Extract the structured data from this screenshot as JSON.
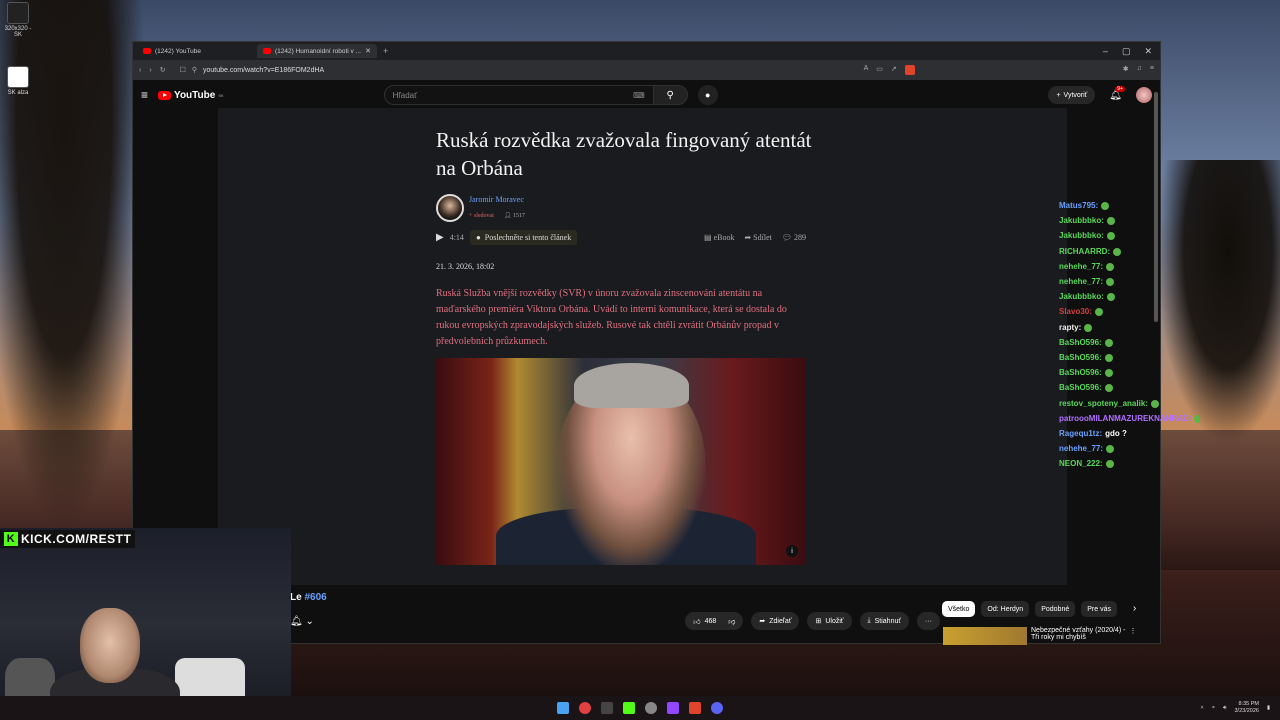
{
  "desktop": {
    "icon1_label": "320x320 - SK",
    "icon2_label": "SK alza"
  },
  "browser": {
    "tabs": [
      {
        "label": "(1242) YouTube"
      },
      {
        "label": "(1242) Humanoidní roboti v ..."
      }
    ],
    "url": "youtube.com/watch?v=E186FOM2dHA"
  },
  "youtube": {
    "logo_text": "YouTube",
    "logo_region": "SK",
    "search_placeholder": "Hľadať",
    "create_label": "Vytvoriť",
    "notif_count": "9+"
  },
  "article": {
    "title": "Ruská rozvědka zvažovala fingovaný atentát na Orbána",
    "author": "Jaromír Moravec",
    "follow": "+ sledovat",
    "readers": "1517",
    "audio_time": "4:14",
    "listen_label": "Poslechněte si tento článek",
    "ebook": "eBook",
    "share": "Sdílet",
    "comments": "289",
    "date": "21. 3. 2026, 18:02",
    "perex": "Ruská Služba vnější rozvědky (SVR) v únoru zvažovala zinscenování atentátu na maďarského premiéra Viktora Orbána. Uvádí to interní komunikace, která se dostala do rukou evropských zpravodajských služeb. Rusové tak chtěli zvrátit Orbánův propad v předvolebních průzkumech."
  },
  "chat": [
    {
      "user": "Matus795:",
      "msg": "",
      "color": "#6aa0ff"
    },
    {
      "user": "Jakubbbko:",
      "msg": "",
      "color": "#5ad85a"
    },
    {
      "user": "Jakubbbko:",
      "msg": "",
      "color": "#5ad85a"
    },
    {
      "user": "RICHAARRD:",
      "msg": "",
      "color": "#5ad85a"
    },
    {
      "user": "nehehe_77:",
      "msg": "",
      "color": "#5ad85a"
    },
    {
      "user": "nehehe_77:",
      "msg": "",
      "color": "#5ad85a"
    },
    {
      "user": "Jakubbbko:",
      "msg": "",
      "color": "#5ad85a"
    },
    {
      "user": "Slavo30:",
      "msg": "",
      "color": "#d04040"
    },
    {
      "user": "rapty:",
      "msg": "",
      "color": "#eeeeee"
    },
    {
      "user": "BaShO596:",
      "msg": "",
      "color": "#5ad85a"
    },
    {
      "user": "BaShO596:",
      "msg": "",
      "color": "#5ad85a"
    },
    {
      "user": "BaShO596:",
      "msg": "",
      "color": "#5ad85a"
    },
    {
      "user": "BaShO596:",
      "msg": "",
      "color": "#5ad85a"
    },
    {
      "user": "restov_spoteny_analik:",
      "msg": "",
      "color": "#5ad85a"
    },
    {
      "user": "patroooMILANMAZUREKNAHRAD:",
      "msg": "",
      "color": "#b070ff"
    },
    {
      "user": "Ragequ1tz:",
      "msg": "gdo ?",
      "color": "#6aa0ff"
    },
    {
      "user": "nehehe_77:",
      "msg": "",
      "color": "#6aa0ff"
    },
    {
      "user": "NEON_222:",
      "msg": "",
      "color": "#5ad85a"
    }
  ],
  "video": {
    "title_prefix": "Le",
    "title_hash": "#606",
    "likes": "468",
    "share": "Zdieľať",
    "save": "Uložiť",
    "download": "Stiahnuť",
    "more": "···"
  },
  "chips": [
    "Všetko",
    "Od: Herdyn",
    "Podobné",
    "Pre vás"
  ],
  "recommended": {
    "title_line1": "Nebezpečné vzťahy (2020/4) -",
    "title_line2": "Tři roky mi chybíš"
  },
  "stream": {
    "kick_text": "KICK.COM/RESTT"
  },
  "taskbar": {
    "time": "8:35 PM",
    "date": "3/23/2026"
  }
}
